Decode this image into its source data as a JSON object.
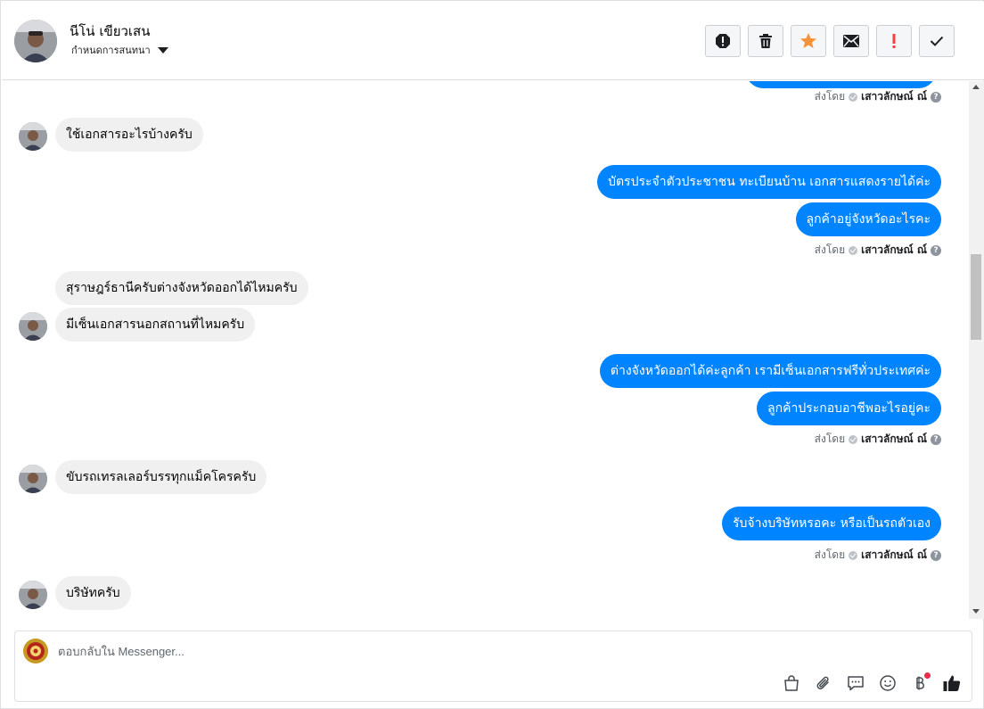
{
  "header": {
    "contact_name": "นีโน่ เขียวเสน",
    "assign_label": "กำหนดการสนทนา"
  },
  "toolbar": [
    {
      "name": "report-spam-button",
      "icon": "alert-octagon-icon"
    },
    {
      "name": "delete-button",
      "icon": "trash-icon"
    },
    {
      "name": "star-button",
      "icon": "star-icon"
    },
    {
      "name": "mark-unread-button",
      "icon": "envelope-icon"
    },
    {
      "name": "follow-up-button",
      "icon": "exclamation-icon"
    },
    {
      "name": "mark-done-button",
      "icon": "checkmark-icon"
    }
  ],
  "conversation": {
    "sent_by_prefix": "ส่งโดย",
    "agent_name": "เสาวลักษณ์ ณ์",
    "messages": [
      {
        "dir": "in",
        "text": "ใช้เอกสารอะไรบ้างครับ"
      },
      {
        "dir": "out",
        "text": "บัตรประจำตัวประชาชน ทะเบียนบ้าน เอกสารแสดงรายได้ค่ะ"
      },
      {
        "dir": "out",
        "text": "ลูกค้าอยู่จังหวัดอะไรคะ"
      },
      {
        "dir": "in",
        "text": "สุราษฎร์ธานีครับต่างจังหวัดออกได้ไหมครับ"
      },
      {
        "dir": "in",
        "text": "มีเซ็นเอกสารนอกสถานที่ไหมครับ"
      },
      {
        "dir": "out",
        "text": "ต่างจังหวัดออกได้ค่ะลูกค้า เรามีเซ็นเอกสารฟรีทั่วประเทศค่ะ"
      },
      {
        "dir": "out",
        "text": "ลูกค้าประกอบอาชีพอะไรอยู่คะ"
      },
      {
        "dir": "in",
        "text": "ขับรถเทรลเลอร์บรรทุกแม็คโครครับ"
      },
      {
        "dir": "out",
        "text": "รับจ้างบริษัทหรอคะ หรือเป็นรถตัวเอง"
      },
      {
        "dir": "in",
        "text": "บริษัทครับ"
      }
    ]
  },
  "composer": {
    "placeholder": "ตอบกลับใน Messenger..."
  },
  "colors": {
    "outgoing_bubble": "#0084ff",
    "incoming_bubble": "#f0f0f0",
    "star": "#f7923b",
    "follow_up": "#fa3e3e",
    "notification_dot": "#f02849"
  }
}
